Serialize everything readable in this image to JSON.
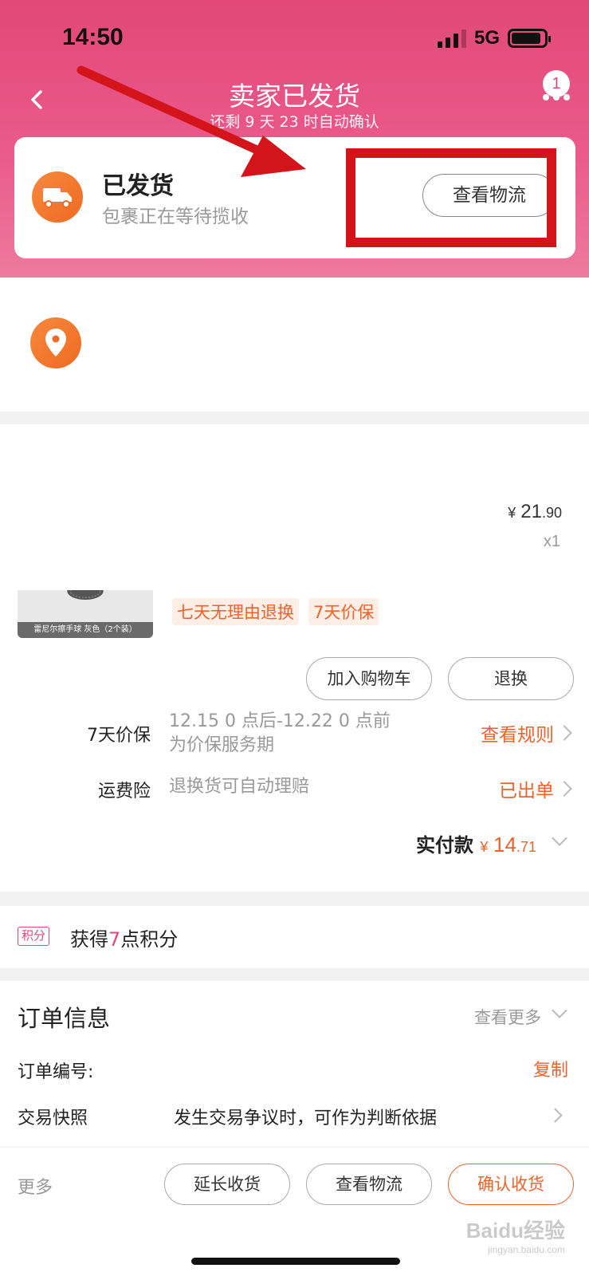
{
  "status_bar": {
    "time": "14:50",
    "network": "5G"
  },
  "nav": {
    "title": "卖家已发货",
    "subtitle": "还剩 9 天 23 时自动确认",
    "badge_count": "1"
  },
  "shipping": {
    "title": "已发货",
    "subtitle": "包裹正在等待揽收",
    "logistics_button": "查看物流"
  },
  "product": {
    "price_currency": "¥",
    "price_int": "21",
    "price_dec": ".90",
    "quantity": "x1",
    "thumb_caption": "雷尼尔擦手球 灰色（2个装）",
    "tags": [
      "七天无理由退换",
      "7天价保"
    ],
    "add_to_cart": "加入购物车",
    "return_exchange": "退换"
  },
  "services": {
    "price_protect_label": "7天价保",
    "price_protect_desc": "12.15 0 点后-12.22 0 点前为价保服务期",
    "price_protect_link": "查看规则",
    "shipping_ins_label": "运费险",
    "shipping_ins_desc": "退换货可自动理赔",
    "shipping_ins_link": "已出单"
  },
  "payment": {
    "label": "实付款",
    "currency": "¥",
    "int": "14",
    "dec": ".71"
  },
  "points": {
    "badge": "积分",
    "prefix": "获得",
    "count": "7",
    "suffix": "点积分"
  },
  "order_info": {
    "title": "订单信息",
    "more": "查看更多",
    "order_no_label": "订单编号:",
    "copy": "复制",
    "snapshot_label": "交易快照",
    "snapshot_desc": "发生交易争议时，可作为判断依据"
  },
  "bottom_bar": {
    "more": "更多",
    "extend": "延长收货",
    "logistics": "查看物流",
    "confirm": "确认收货"
  },
  "watermark": {
    "brand": "Baidu经验",
    "url": "jingyan.baidu.com"
  },
  "colors": {
    "header": "#e2487a",
    "accent": "#f0622a",
    "annotation": "#d3141b"
  }
}
